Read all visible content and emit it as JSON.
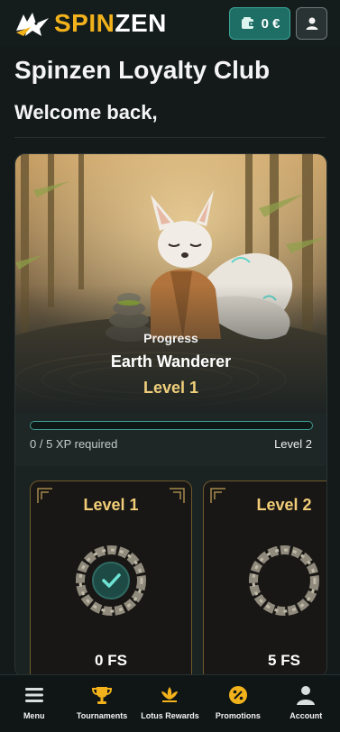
{
  "header": {
    "logo_text_a": "SPIN",
    "logo_text_b": "ZEN",
    "balance": "0 €"
  },
  "page": {
    "title": "Spinzen Loyalty Club",
    "welcome": "Welcome back,"
  },
  "progress": {
    "label": "Progress",
    "rank": "Earth Wanderer",
    "level": "Level 1",
    "xp_text": "0 / 5 XP required",
    "next_level": "Level 2",
    "value": 0.0
  },
  "levels": [
    {
      "title": "Level 1",
      "reward": "0 FS",
      "completed": true
    },
    {
      "title": "Level 2",
      "reward": "5 FS",
      "completed": false
    }
  ],
  "nav": {
    "items": [
      {
        "label": "Menu",
        "icon": "hamburger-menu-icon"
      },
      {
        "label": "Tournaments",
        "icon": "trophy-icon"
      },
      {
        "label": "Lotus Rewards",
        "icon": "lotus-icon"
      },
      {
        "label": "Promotions",
        "icon": "percent-badge-icon"
      },
      {
        "label": "Account",
        "icon": "person-icon"
      }
    ]
  },
  "colors": {
    "accent_gold": "#f2b21b",
    "teal": "#3d9c8f",
    "background": "#141a1a"
  }
}
